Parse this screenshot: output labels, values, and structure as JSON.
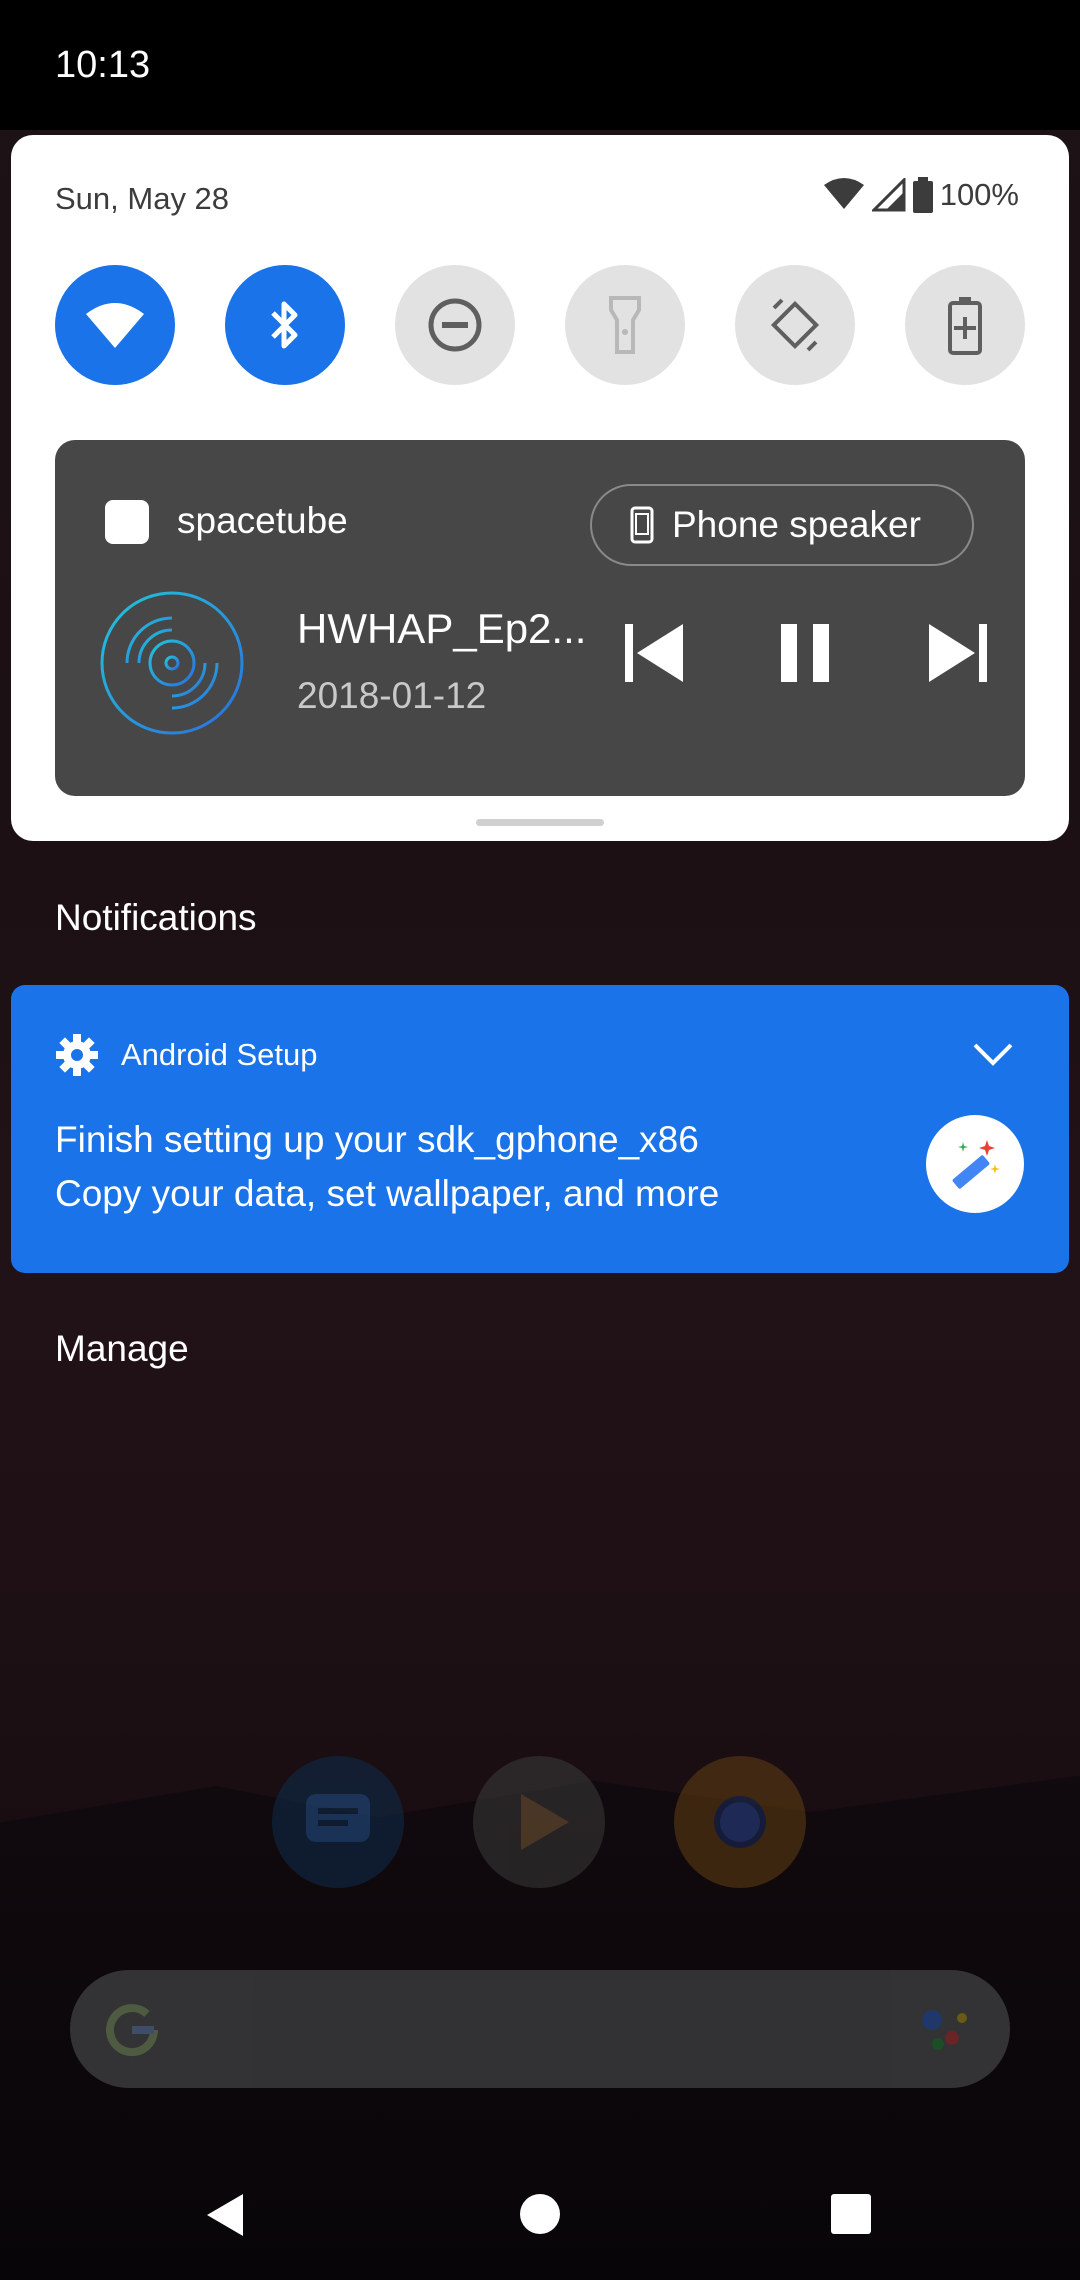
{
  "status_bar": {
    "time": "10:13"
  },
  "quick_settings": {
    "date": "Sun, May 28",
    "battery": "100%",
    "tiles": [
      {
        "name": "Wi-Fi",
        "icon": "wifi-icon",
        "state": "on"
      },
      {
        "name": "Bluetooth",
        "icon": "bluetooth-icon",
        "state": "on"
      },
      {
        "name": "Do Not Disturb",
        "icon": "dnd-icon",
        "state": "off"
      },
      {
        "name": "Flashlight",
        "icon": "flashlight-icon",
        "state": "disabled"
      },
      {
        "name": "Auto-rotate",
        "icon": "rotate-icon",
        "state": "off"
      },
      {
        "name": "Battery Saver",
        "icon": "battery-saver-icon",
        "state": "off"
      }
    ]
  },
  "media": {
    "app_name": "spacetube",
    "output_label": "Phone speaker",
    "track_title": "HWHAP_Ep2...",
    "track_date": "2018-01-12"
  },
  "notifications": {
    "header": "Notifications",
    "items": [
      {
        "app": "Android Setup",
        "title": "Finish setting up your sdk_gphone_x86",
        "text": "Copy your data, set wallpaper, and more"
      }
    ],
    "manage_label": "Manage"
  },
  "colors": {
    "accent": "#1a73e8",
    "media_bg": "#474747"
  }
}
